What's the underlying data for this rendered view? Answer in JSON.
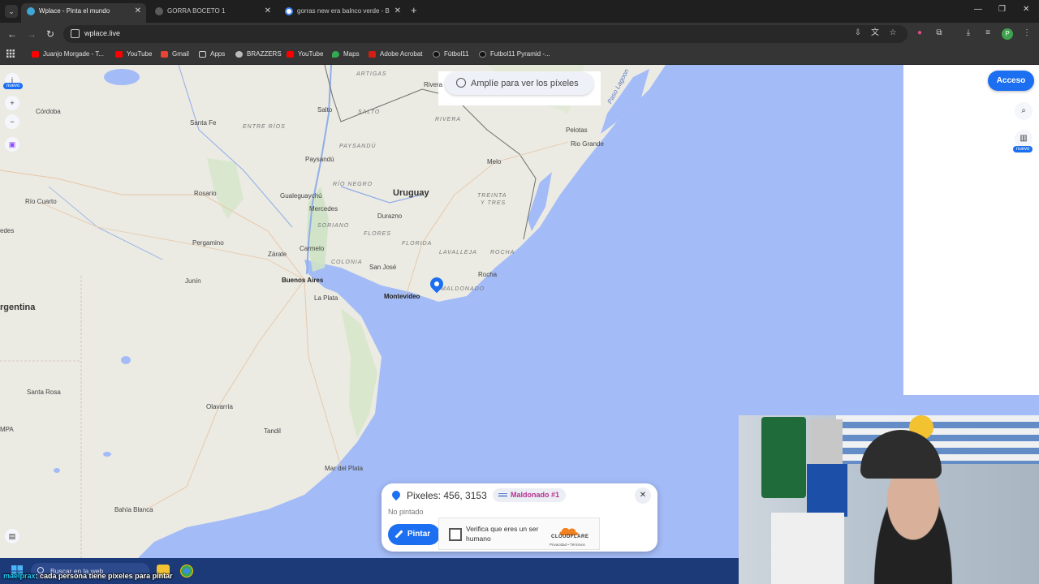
{
  "browser": {
    "tabs": [
      {
        "title": "Wplace - Pinta el mundo",
        "active": true
      },
      {
        "title": "GORRA BOCETO 1",
        "active": false
      },
      {
        "title": "gorras new era balnco verde - B",
        "active": false
      }
    ],
    "url": "wplace.live",
    "profile_initial": "P",
    "bookmarks": [
      {
        "label": "Juanjo Morgade - T...",
        "icon": "youtube-icon"
      },
      {
        "label": "YouTube",
        "icon": "youtube-icon"
      },
      {
        "label": "Gmail",
        "icon": "gmail-icon"
      },
      {
        "label": "Apps",
        "icon": "folder-icon"
      },
      {
        "label": "BRAZZERS",
        "icon": "globe-icon"
      },
      {
        "label": "YouTube",
        "icon": "youtube-icon"
      },
      {
        "label": "Maps",
        "icon": "maps-icon"
      },
      {
        "label": "Adobe Acrobat",
        "icon": "acrobat-icon"
      },
      {
        "label": "Fútbol11",
        "icon": "futbol11-icon"
      },
      {
        "label": "Futbol11 Pyramid -...",
        "icon": "futbol11-icon"
      }
    ]
  },
  "map": {
    "zoom_hint": "Amplíe para ver los píxeles",
    "login_button": "Acceso",
    "new_badge": "nuevo",
    "labels": {
      "regions": [
        "ARTIGAS",
        "SALTO",
        "RIVERA",
        "PAYSANDÚ",
        "ENTRE RÍOS",
        "RÍO NEGRO",
        "TREINTA Y TRES",
        "SORIANO",
        "FLORES",
        "FLORIDA",
        "LAVALLEJA",
        "ROCHA",
        "COLONIA",
        "MALDONADO"
      ],
      "treinta": "TREINTA",
      "y_tres": "Y TRES",
      "country_uruguay": "Uruguay",
      "country_argentina": "rgentina",
      "capital_ba": "Buenos Aires",
      "capital_mvd": "Montevideo",
      "water": "Paso Lagoon",
      "cities": [
        "Rivera",
        "Salto",
        "Pelotas",
        "Rio Grande",
        "Melo",
        "Córdoba",
        "Santa Fe",
        "Paysandú",
        "Rosario",
        "Gualeguaychú",
        "Mercedes",
        "Durazno",
        "Río Cuarto",
        "Pergamino",
        "Zárate",
        "Carmelo",
        "San José",
        "Rocha",
        "Junín",
        "La Plata",
        "Santa Rosa",
        "Olavarría",
        "Tandil",
        "Mar del Plata",
        "Bahía Blanca",
        "edes",
        "MPA"
      ]
    }
  },
  "pixel_panel": {
    "title": "Pixeles: 456, 3153",
    "region_tag": "Maldonado #1",
    "status": "No pintado",
    "paint_button": "Pintar",
    "captcha_text": "Verifica que eres un ser humano",
    "captcha_brand": "CLOUDFLARE",
    "captcha_links": "Privacidad • Términos"
  },
  "taskbar": {
    "search_placeholder": "Buscar en la web"
  },
  "overlay": {
    "chat_user": "maelprax",
    "chat_message": ": cada persona tiene pixeles para pintar"
  },
  "colors": {
    "accent": "#1b6ff0",
    "water": "#a3bbf7",
    "land": "#ebeae3",
    "region_tag": "#b5318f"
  }
}
